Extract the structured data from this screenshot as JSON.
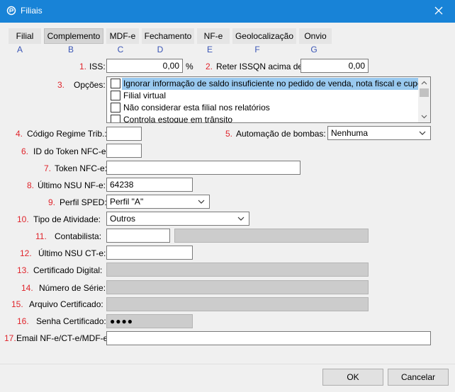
{
  "window": {
    "title": "Filiais",
    "icon": "app-logo-icon",
    "close_icon": "close-icon"
  },
  "tabs": [
    {
      "label": "Filial",
      "letter": "A"
    },
    {
      "label": "Complemento",
      "letter": "B",
      "active": true
    },
    {
      "label": "MDF-e",
      "letter": "C"
    },
    {
      "label": "Fechamento",
      "letter": "D"
    },
    {
      "label": "NF-e",
      "letter": "E"
    },
    {
      "label": "Geolocalização",
      "letter": "F"
    },
    {
      "label": "Onvio",
      "letter": "G"
    }
  ],
  "fields": {
    "iss": {
      "num": "1.",
      "label": "ISS:",
      "value": "0,00",
      "unit": "%"
    },
    "reter_issqn": {
      "num": "2.",
      "label": "Reter ISSQN acima de:",
      "value": "0,00"
    },
    "opcoes": {
      "num": "3.",
      "label": "Opções:",
      "items": [
        {
          "text": "Ignorar informação de saldo insuficiente no pedido de venda, nota fiscal e cupom",
          "checked": false,
          "selected": true
        },
        {
          "text": "Filial virtual",
          "checked": false
        },
        {
          "text": "Não considerar esta filial nos relatórios",
          "checked": false
        },
        {
          "text": "Controla estoque em trânsito",
          "checked": false
        }
      ]
    },
    "codigo_regime": {
      "num": "4.",
      "label": "Código Regime Trib.:",
      "value": ""
    },
    "automacao": {
      "num": "5.",
      "label": "Automação de bombas:",
      "value": "Nenhuma"
    },
    "id_token": {
      "num": "6.",
      "label": "ID do Token NFC-e:",
      "value": ""
    },
    "token_nfce": {
      "num": "7.",
      "label": "Token NFC-e:",
      "value": ""
    },
    "ultimo_nsu_nfe": {
      "num": "8.",
      "label": "Último NSU NF-e:",
      "value": "64238"
    },
    "perfil_sped": {
      "num": "9.",
      "label": "Perfil SPED:",
      "value": "Perfil \"A\""
    },
    "tipo_atividade": {
      "num": "10.",
      "label": "Tipo de Atividade:",
      "value": "Outros"
    },
    "contabilista": {
      "num": "11.",
      "label": "Contabilista:",
      "value": "",
      "name": ""
    },
    "ultimo_nsu_cte": {
      "num": "12.",
      "label": "Último NSU CT-e:",
      "value": ""
    },
    "certificado": {
      "num": "13.",
      "label": "Certificado Digital:",
      "value": ""
    },
    "numero_serie": {
      "num": "14.",
      "label": "Número de Série:",
      "value": ""
    },
    "arquivo_cert": {
      "num": "15.",
      "label": "Arquivo Certificado:",
      "value": ""
    },
    "senha_cert": {
      "num": "16.",
      "label": "Senha Certificado:",
      "value": "●●●●"
    },
    "email": {
      "num": "17.",
      "label": "Email NF-e/CT-e/MDF-e:",
      "value": ""
    }
  },
  "buttons": {
    "ok": "OK",
    "cancel": "Cancelar"
  },
  "colors": {
    "titlebar": "#1883d7",
    "number": "#e0242b",
    "tab_letter": "#3a55b5",
    "selection": "#99c9ef"
  }
}
